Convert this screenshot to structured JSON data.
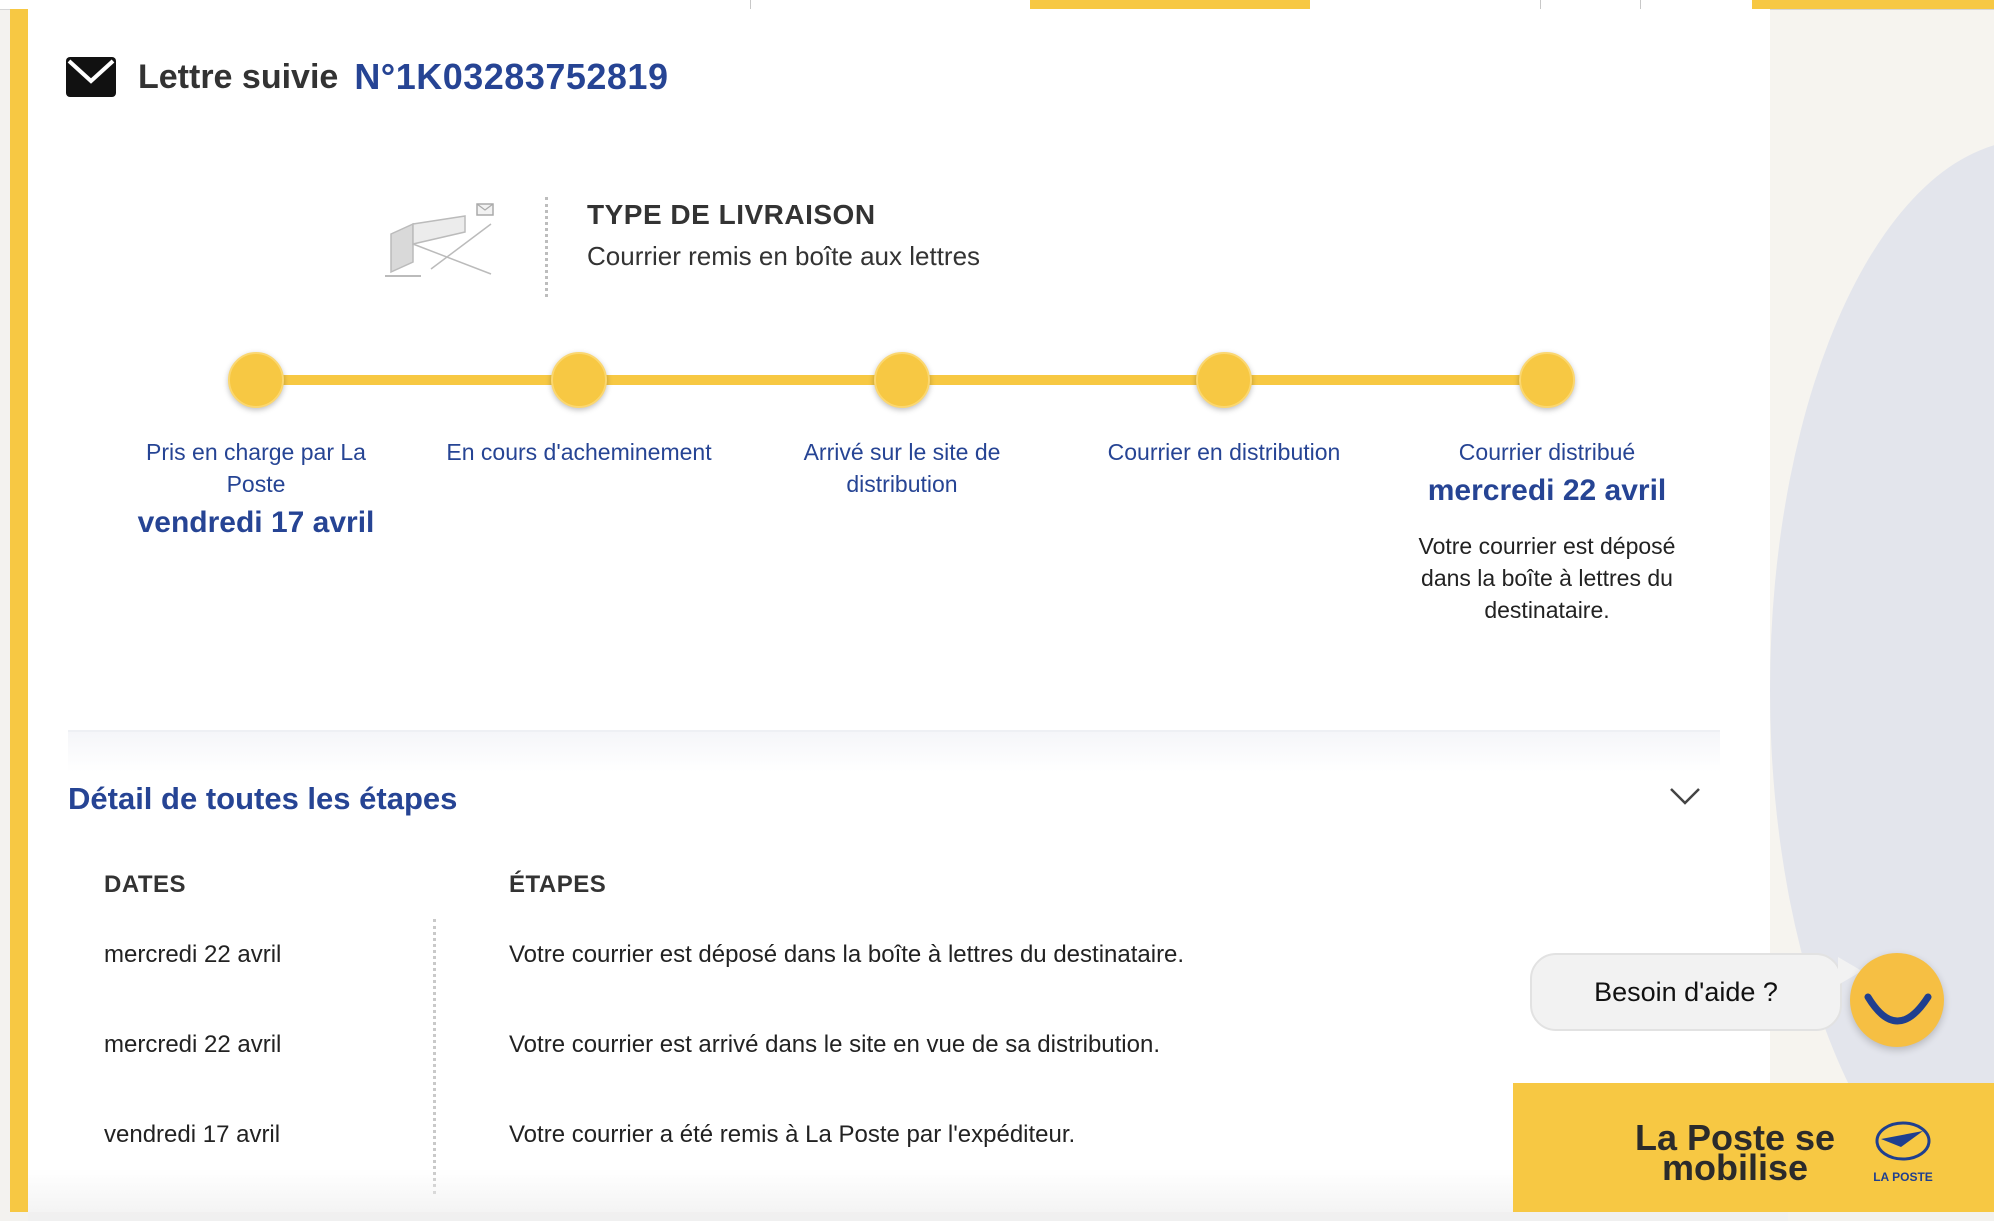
{
  "header": {
    "title": "Lettre suivie",
    "tracking_number": "N°1K03283752819"
  },
  "delivery_type": {
    "label": "TYPE DE LIVRAISON",
    "value": "Courrier remis en boîte aux lettres"
  },
  "timeline": {
    "steps": [
      {
        "label": "Pris en charge par La Poste",
        "date": "vendredi 17 avril",
        "description": ""
      },
      {
        "label": "En cours d'acheminement",
        "date": "",
        "description": ""
      },
      {
        "label": "Arrivé sur le site de distribution",
        "date": "",
        "description": ""
      },
      {
        "label": "Courrier en distribution",
        "date": "",
        "description": ""
      },
      {
        "label": "Courrier distribué",
        "date": "mercredi 22 avril",
        "description": "Votre courrier est déposé dans la boîte à lettres du destinataire."
      }
    ]
  },
  "details": {
    "title": "Détail de toutes les étapes",
    "columns": {
      "dates": "DATES",
      "steps": "ÉTAPES"
    },
    "rows": [
      {
        "date": "mercredi 22 avril",
        "step": "Votre courrier est déposé dans la boîte à lettres du destinataire."
      },
      {
        "date": "mercredi 22 avril",
        "step": "Votre courrier est arrivé dans le site en vue de sa distribution."
      },
      {
        "date": "vendredi 17 avril",
        "step": "Votre courrier a été remis à La Poste par l'expéditeur."
      }
    ]
  },
  "help": {
    "label": "Besoin d'aide ?"
  },
  "banner": {
    "text": "La Poste se mobilise",
    "logo_text": "LA POSTE"
  },
  "colors": {
    "accent": "#f7c843",
    "brand_blue": "#264494"
  },
  "icons": [
    "envelope-icon",
    "mailbox-illustration",
    "chevron-down-icon",
    "chat-avatar-icon",
    "la-poste-logo"
  ]
}
